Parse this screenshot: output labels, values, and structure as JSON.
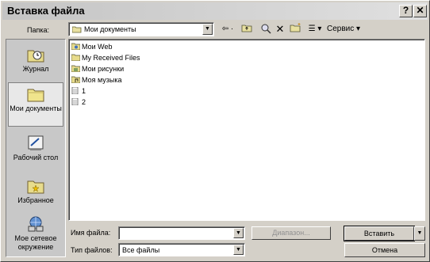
{
  "window": {
    "title": "Вставка файла",
    "help_glyph": "?",
    "close_glyph": "✕"
  },
  "lookin": {
    "label": "Папка:",
    "value": "Мои документы"
  },
  "toolbar": {
    "back": "⇦ ·",
    "up": "🗀",
    "search": "🔍",
    "delete": "✕",
    "newfolder": "📁",
    "views": "☰ ▾",
    "tools": "Сервис ▾"
  },
  "places": [
    {
      "label": "Журнал",
      "icon": "history-icon"
    },
    {
      "label": "Мои документы",
      "icon": "my-documents-icon"
    },
    {
      "label": "Рабочий стол",
      "icon": "desktop-icon"
    },
    {
      "label": "Избранное",
      "icon": "favorites-icon"
    },
    {
      "label": "Мое сетевое окружение",
      "icon": "network-places-icon"
    }
  ],
  "files": [
    {
      "name": "Мои Web",
      "icon": "web-folder-icon"
    },
    {
      "name": "My Received Files",
      "icon": "folder-icon"
    },
    {
      "name": "Мои рисунки",
      "icon": "pictures-folder-icon"
    },
    {
      "name": "Моя музыка",
      "icon": "music-folder-icon"
    },
    {
      "name": "1",
      "icon": "file-icon"
    },
    {
      "name": "2",
      "icon": "file-icon"
    }
  ],
  "filename": {
    "label": "Имя файла:",
    "value": ""
  },
  "filetype": {
    "label": "Тип файлов:",
    "value": "Все файлы"
  },
  "buttons": {
    "range": "Диапазон...",
    "insert": "Вставить",
    "cancel": "Отмена"
  }
}
